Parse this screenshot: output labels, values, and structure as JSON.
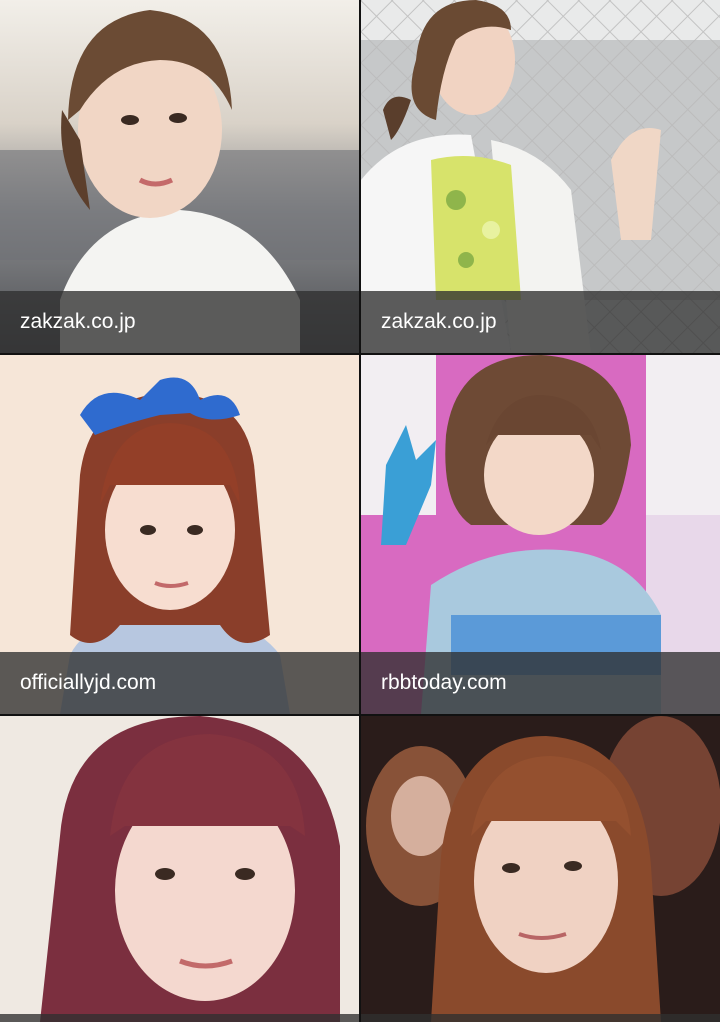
{
  "results": [
    {
      "source": "zakzak.co.jp"
    },
    {
      "source": "zakzak.co.jp"
    },
    {
      "source": "officiallyjd.com"
    },
    {
      "source": "rbbtoday.com"
    },
    {
      "source": ""
    },
    {
      "source": ""
    }
  ],
  "colors": {
    "caption_bg": "#303030",
    "caption_text": "#ffffff",
    "grid_gap": "#111111"
  }
}
